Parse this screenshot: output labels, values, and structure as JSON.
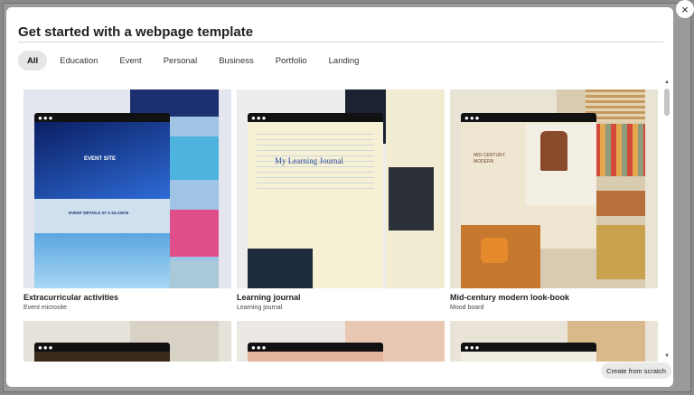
{
  "dialog": {
    "title": "Get started with a webpage template",
    "close_icon": "×",
    "create_button": "Create from scratch"
  },
  "filters": [
    {
      "label": "All",
      "active": true
    },
    {
      "label": "Education",
      "active": false
    },
    {
      "label": "Event",
      "active": false
    },
    {
      "label": "Personal",
      "active": false
    },
    {
      "label": "Business",
      "active": false
    },
    {
      "label": "Portfolio",
      "active": false
    },
    {
      "label": "Landing",
      "active": false
    }
  ],
  "templates": [
    {
      "title": "Extracurricular activities",
      "subtitle": "Event microsite",
      "preview_heading": "EVENT SITE",
      "preview_band": "EVENT DETAILS AT A GLANCE"
    },
    {
      "title": "Learning journal",
      "subtitle": "Learning journal",
      "preview_heading": "My Learning Journal"
    },
    {
      "title": "Mid-century modern look-book",
      "subtitle": "Mood board",
      "preview_heading": "MID-CENTURY MODERN"
    }
  ],
  "colors": {
    "accent_blue": "#2e6bd6",
    "journal_paper": "#f6f1d4",
    "midcentury_beige": "#e8dcc4",
    "pill_active": "#e6e6e6"
  }
}
